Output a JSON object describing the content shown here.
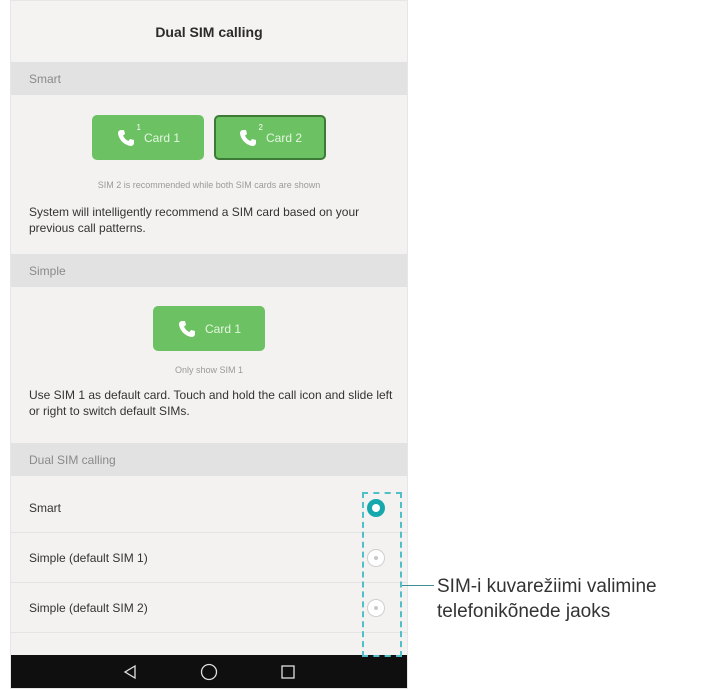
{
  "screen": {
    "title": "Dual SIM calling"
  },
  "smart_section": {
    "header": "Smart",
    "cards": [
      {
        "label": "Card 1",
        "sim": "1",
        "selected": false
      },
      {
        "label": "Card 2",
        "sim": "2",
        "selected": true
      }
    ],
    "caption": "SIM 2 is recommended while both SIM cards are shown",
    "description": "System will intelligently recommend a SIM card based on your previous call patterns."
  },
  "simple_section": {
    "header": "Simple",
    "card": {
      "label": "Card 1",
      "sim": "1"
    },
    "caption": "Only show SIM 1",
    "description": "Use SIM 1 as default card. Touch and hold the call icon and slide left or right to switch default SIMs."
  },
  "mode_section": {
    "header": "Dual SIM calling",
    "options": [
      {
        "label": "Smart",
        "selected": true
      },
      {
        "label": "Simple (default SIM 1)",
        "selected": false
      },
      {
        "label": "Simple (default SIM 2)",
        "selected": false
      }
    ]
  },
  "navbar": {
    "icons": [
      "back-icon",
      "home-icon",
      "recents-icon"
    ],
    "color": "#0f0f0f"
  },
  "callout": {
    "text": "SIM-i kuvarežiimi valimine telefonikõnede jaoks",
    "border_color": "#4fc0c8"
  },
  "colors": {
    "accent": "#15a9ae",
    "card_green": "#6cc263",
    "card_selected_border": "#3c7a36"
  }
}
